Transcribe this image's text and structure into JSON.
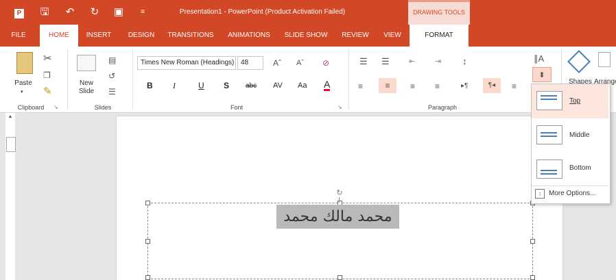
{
  "app": {
    "title": "Presentation1 - PowerPoint (Product Activation Failed)",
    "contextual_group": "DRAWING TOOLS",
    "accent": "#d24726"
  },
  "tabs": [
    "FILE",
    "HOME",
    "INSERT",
    "DESIGN",
    "TRANSITIONS",
    "ANIMATIONS",
    "SLIDE SHOW",
    "REVIEW",
    "VIEW",
    "FORMAT"
  ],
  "clipboard": {
    "paste": "Paste",
    "group": "Clipboard"
  },
  "slides": {
    "new_slide": "New Slide",
    "group": "Slides"
  },
  "font": {
    "family": "Times New Roman (Headings)",
    "size": "48",
    "bold": "B",
    "italic": "I",
    "underline": "U",
    "shadow": "S",
    "strike": "abc",
    "spacing": "AV",
    "case": "Aa",
    "color": "A",
    "group": "Font"
  },
  "paragraph": {
    "group": "Paragraph"
  },
  "drawing": {
    "shapes": "Shapes",
    "arrange": "Arrange"
  },
  "slide_text": "محمد مالك محمد",
  "align_dropdown": {
    "items": [
      "Top",
      "Middle",
      "Bottom"
    ],
    "more": "More Options..."
  }
}
